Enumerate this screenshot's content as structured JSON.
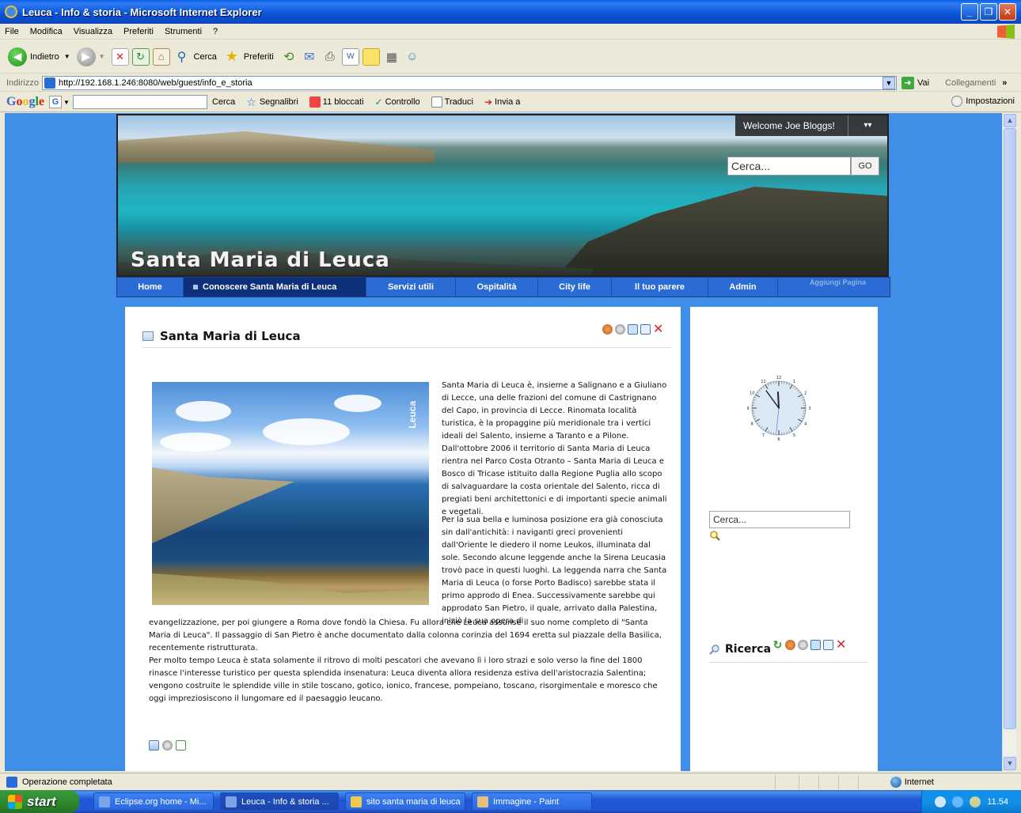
{
  "window": {
    "title": "Leuca - Info & storia - Microsoft Internet Explorer"
  },
  "menu": [
    "File",
    "Modifica",
    "Visualizza",
    "Preferiti",
    "Strumenti",
    "?"
  ],
  "toolbar": {
    "back": "Indietro",
    "search": "Cerca",
    "favorites": "Preferiti"
  },
  "address": {
    "label": "Indirizzo",
    "url": "http://192.168.1.246:8080/web/guest/info_e_storia",
    "go": "Vai",
    "links": "Collegamenti"
  },
  "googlebar": {
    "search": "Cerca",
    "bookmarks": "Segnalibri",
    "blocked": "11 bloccati",
    "spellcheck": "Controllo",
    "translate": "Traduci",
    "send": "Invia a",
    "settings": "Impostazioni"
  },
  "site": {
    "title": "Santa Maria di Leuca",
    "welcome": "Welcome Joe Bloggs!",
    "search_placeholder": "Cerca...",
    "go": "GO"
  },
  "nav": {
    "items": [
      "Home",
      "Conoscere Santa Maria di Leuca",
      "Servizi utili",
      "Ospitalità",
      "City life",
      "Il tuo parere",
      "Admin"
    ],
    "add_page": "Aggiungi Pagina"
  },
  "portlet_main": {
    "title": "Santa Maria di Leuca",
    "photo_caption": "Leuca",
    "p1": "Santa Maria di Leuca è, insieme a Salignano e a Giuliano di Lecce, una delle frazioni del comune di Castrignano del Capo, in provincia di Lecce. Rinomata località turistica, è la propaggine più meridionale tra i vertici ideali del Salento, insieme a Taranto e a Pilone. Dall'ottobre 2006 il territorio di Santa Maria di Leuca rientra nel Parco Costa Otranto – Santa Maria di Leuca e Bosco di Tricase istituito dalla Regione Puglia allo scopo di salvaguardare la costa orientale del Salento, ricca di pregiati beni architettonici e di importanti specie animali e vegetali.",
    "p2": "Per la sua bella e luminosa posizione era già conosciuta sin dall'antichità: i naviganti greci provenienti dall'Oriente le diedero il nome Leukos, illuminata dal sole. Secondo alcune leggende anche la Sirena Leucasia trovò pace in questi luoghi. La leggenda narra che Santa Maria di Leuca (o forse Porto Badisco) sarebbe stata il primo approdo di Enea. Successivamente sarebbe qui approdato San Pietro, il quale, arrivato dalla Palestina, iniziò la sua opera di",
    "p3": "evangelizzazione, per poi giungere a Roma dove fondò la Chiesa. Fu allora che Leuca assunse il suo nome completo di \"Santa Maria di Leuca\". Il passaggio di San Pietro è anche documentato dalla colonna corinzia del 1694 eretta sul piazzale della Basilica, recentemente ristrutturata.",
    "p4": "Per molto tempo Leuca è stata solamente  il ritrovo di molti pescatori che avevano lì i loro strazi e solo verso la fine del 1800 rinasce l'interesse turistico per questa splendida insenatura: Leuca diventa allora residenza estiva dell'aristocrazia Salentina; vengono costruite le splendide ville in stile toscano, gotico, ionico, francese, pompeiano, toscano, risorgimentale e moresco che oggi impreziosiscono il lungomare ed il paesaggio leucano."
  },
  "portlet_side": {
    "clock_numbers": [
      "12",
      "1",
      "2",
      "3",
      "4",
      "5",
      "6",
      "7",
      "8",
      "9",
      "10",
      "11"
    ],
    "clock_time": {
      "hours": 11,
      "minutes": 54,
      "seconds": 31
    },
    "search_placeholder": "Cerca...",
    "ricerca_title": "Ricerca"
  },
  "status": {
    "text": "Operazione completata",
    "zone": "Internet"
  },
  "taskbar": {
    "start": "start",
    "tasks": [
      "Eclipse.org home - Mi...",
      "Leuca - Info & storia ...",
      "sito santa maria di leuca",
      "Immagine - Paint"
    ],
    "time": "11.54"
  }
}
